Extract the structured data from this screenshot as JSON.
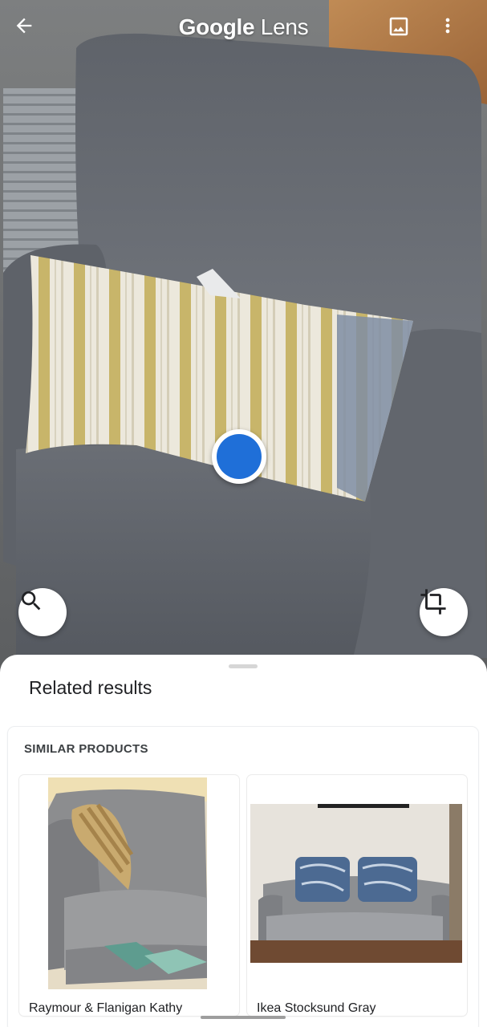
{
  "header": {
    "title_brand": "Google",
    "title_product": "Lens",
    "back_icon": "arrow-back-icon",
    "gallery_icon": "image-icon",
    "more_icon": "more-vert-icon"
  },
  "camera": {
    "focus_indicator_color": "#1f6fd8",
    "search_icon": "search-icon",
    "crop_icon": "crop-icon"
  },
  "sheet": {
    "title": "Related results",
    "section": {
      "heading": "SIMILAR PRODUCTS",
      "products": [
        {
          "name": "Raymour & Flanigan Kathy"
        },
        {
          "name": "Ikea Stocksund Gray"
        }
      ]
    }
  },
  "colors": {
    "accent_blue": "#1f6fd8",
    "sofa_gray": "#6b6f76"
  }
}
